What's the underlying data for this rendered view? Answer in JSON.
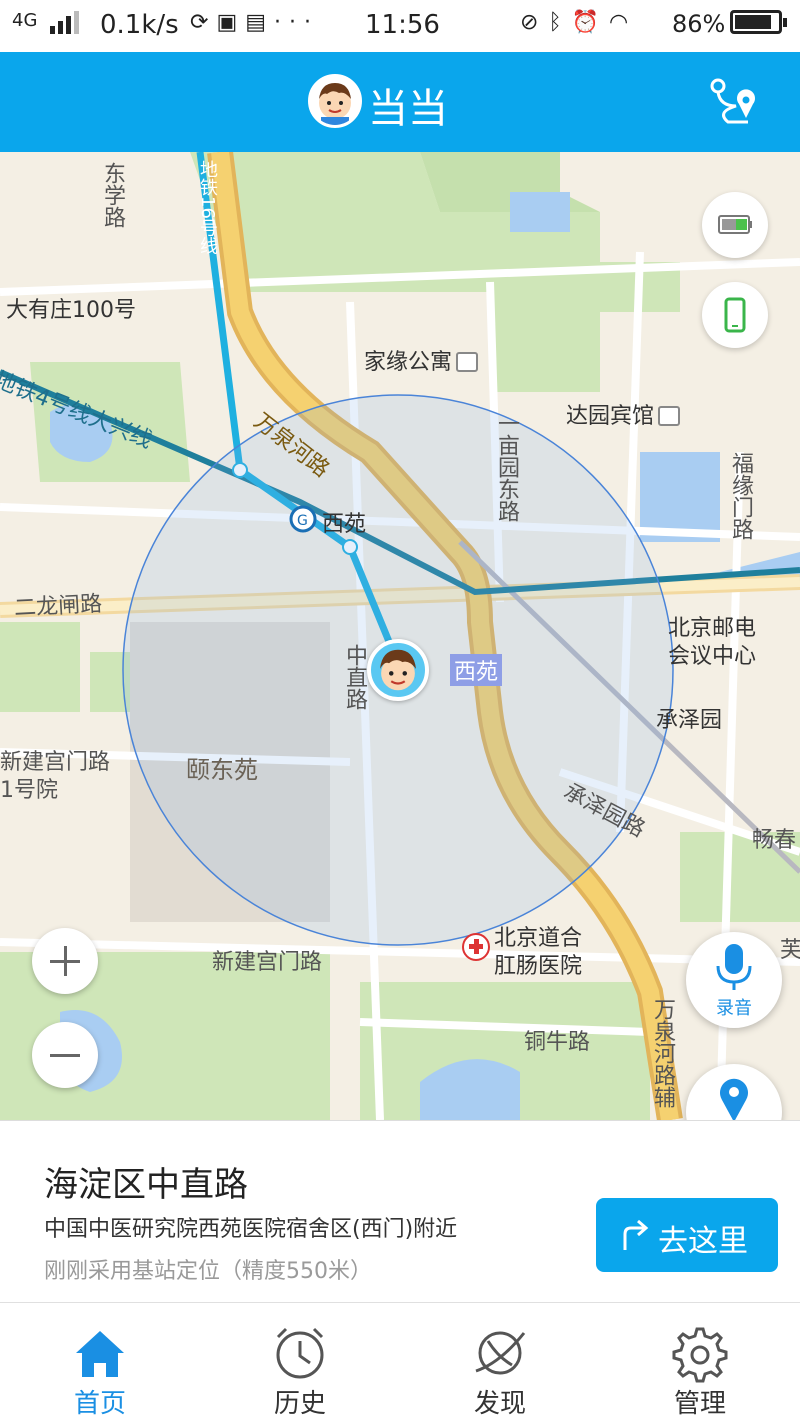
{
  "status_bar": {
    "network": "4G",
    "speed": "0.1k/s",
    "more": "···",
    "time": "11:56",
    "battery_percent": "86%",
    "battery_level": 0.86
  },
  "header": {
    "title": "当当",
    "route_icon": "route-pin-icon",
    "accent_color": "#0aa6ec"
  },
  "map": {
    "labels": {
      "road_xueyuan": "东学路",
      "line16": "地铁16号线",
      "dayouzhuang": "大有庄100号",
      "jiayuan": "家缘公寓",
      "wanquanhe_top": "万泉河路",
      "line4": "地铁4号线大兴线",
      "dayuan_hotel": "达园宾馆",
      "yimuyuan": "一亩园东路",
      "fuyuanmen": "福缘门路",
      "xiyuan_station": "西苑",
      "erlongzha": "二龙闸路",
      "bupt_conf_1": "北京邮电",
      "bupt_conf_2": "会议中心",
      "zhongzhi": "中直路",
      "xiyuan_area": "西苑",
      "chengzeyuan": "承泽园",
      "xinjiangong_left_1": "新建宫门路",
      "xinjiangong_left_2": "1号院",
      "yidongyuan": "颐东苑",
      "chengze_road": "承泽园路",
      "changchun": "畅春",
      "xinjiangong": "新建宫门路",
      "hospital_1": "北京道合",
      "hospital_2": "肛肠医院",
      "tongniu": "铜牛路",
      "wanquanhe_bottom": "万泉河路辅",
      "east_edge": "芙"
    },
    "buttons": {
      "record_label": "录音",
      "locate_label": "定位"
    }
  },
  "location": {
    "title": "海淀区中直路",
    "detail": "中国中医研究院西苑医院宿舍区(西门)附近",
    "note": "刚刚采用基站定位（精度550米）",
    "go_label": "去这里"
  },
  "tabs": [
    {
      "label": "首页",
      "icon": "home-icon",
      "active": true
    },
    {
      "label": "历史",
      "icon": "clock-icon",
      "active": false
    },
    {
      "label": "发现",
      "icon": "planet-icon",
      "active": false
    },
    {
      "label": "管理",
      "icon": "gear-icon",
      "active": false
    }
  ]
}
